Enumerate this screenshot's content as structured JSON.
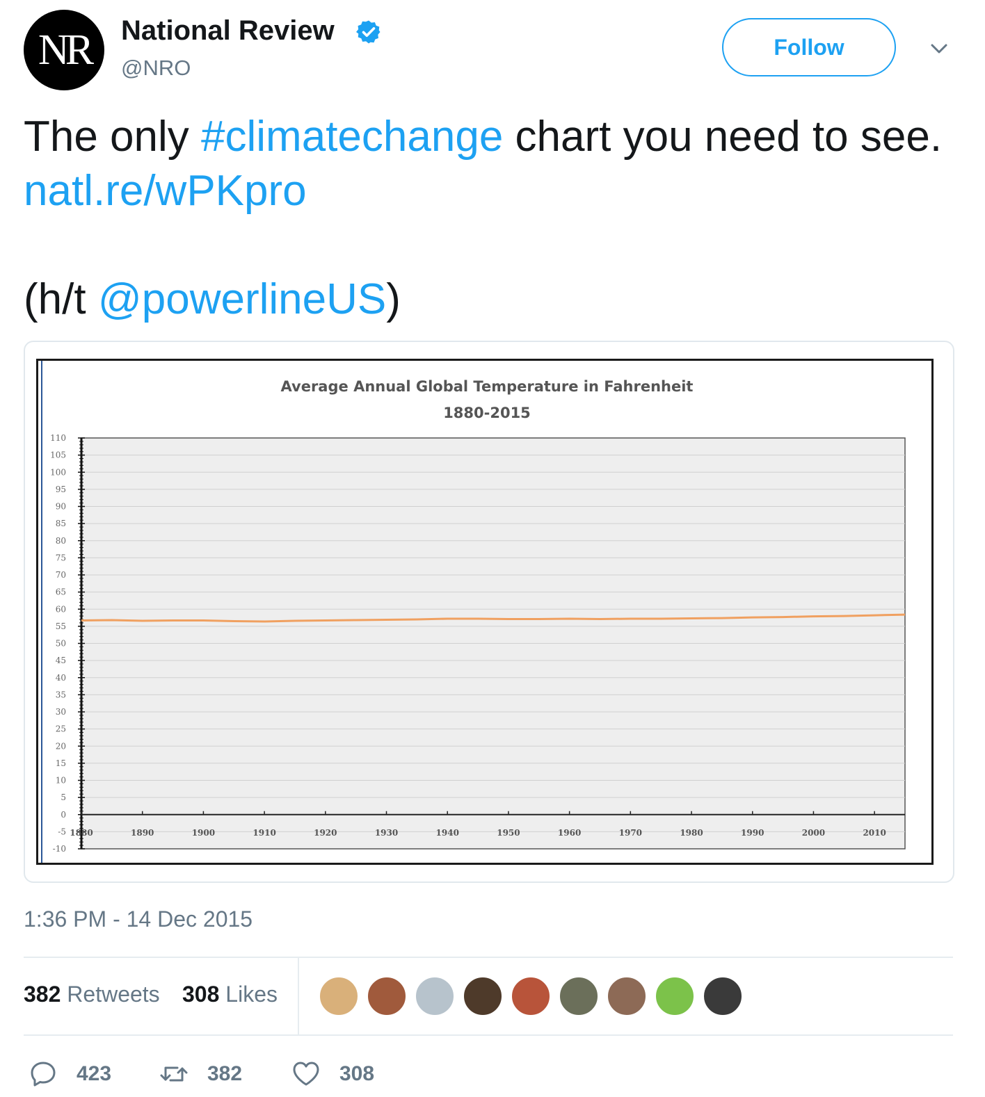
{
  "account": {
    "display_name": "National Review",
    "handle": "@NRO",
    "avatar_text": "NR",
    "verified": true,
    "follow_label": "Follow"
  },
  "tweet": {
    "text_1": "The only ",
    "hashtag": "#climatechange",
    "text_2": " chart you need to see. ",
    "link": "natl.re/wPKpro",
    "ht_open": "(h/t ",
    "mention": "@powerlineUS",
    "ht_close": ")",
    "timestamp": "1:36 PM - 14 Dec 2015"
  },
  "stats": {
    "retweets_count": "382",
    "retweets_label": "Retweets",
    "likes_count": "308",
    "likes_label": "Likes"
  },
  "actions": {
    "replies": "423",
    "retweets": "382",
    "likes": "308"
  },
  "liker_avatars": [
    {
      "name": "liker-avatar-1",
      "color": "#d9b07a"
    },
    {
      "name": "liker-avatar-2",
      "color": "#a05a3c"
    },
    {
      "name": "liker-avatar-3",
      "color": "#b7c3cc"
    },
    {
      "name": "liker-avatar-4",
      "color": "#4e3a2a"
    },
    {
      "name": "liker-avatar-5",
      "color": "#b8543a"
    },
    {
      "name": "liker-avatar-6",
      "color": "#6b6f5a"
    },
    {
      "name": "liker-avatar-7",
      "color": "#8d6a56"
    },
    {
      "name": "liker-avatar-8",
      "color": "#7cc24a"
    },
    {
      "name": "liker-avatar-9",
      "color": "#3a3a3a"
    }
  ],
  "colors": {
    "accent": "#1da1f2",
    "text": "#14171a",
    "muted": "#657786",
    "series": "#f0a060",
    "plot_bg": "#eeeeee"
  },
  "chart_data": {
    "type": "line",
    "title": "Average Annual Global Temperature in Fahrenheit",
    "subtitle": "1880-2015",
    "xlabel": "",
    "ylabel": "",
    "xlim": [
      1880,
      2015
    ],
    "ylim": [
      -10,
      110
    ],
    "y_ticks": [
      110,
      105,
      100,
      95,
      90,
      85,
      80,
      75,
      70,
      65,
      60,
      55,
      50,
      45,
      40,
      35,
      30,
      25,
      20,
      15,
      10,
      5,
      0,
      -5,
      -10
    ],
    "x_ticks": [
      1880,
      1890,
      1900,
      1910,
      1920,
      1930,
      1940,
      1950,
      1960,
      1970,
      1980,
      1990,
      2000,
      2010
    ],
    "grid": true,
    "series": [
      {
        "x": [
          1880,
          1885,
          1890,
          1895,
          1900,
          1905,
          1910,
          1915,
          1920,
          1925,
          1930,
          1935,
          1940,
          1945,
          1950,
          1955,
          1960,
          1965,
          1970,
          1975,
          1980,
          1985,
          1990,
          1995,
          2000,
          2005,
          2010,
          2015
        ],
        "y": [
          56.7,
          56.8,
          56.6,
          56.7,
          56.7,
          56.5,
          56.4,
          56.6,
          56.7,
          56.8,
          56.9,
          57.0,
          57.2,
          57.2,
          57.1,
          57.1,
          57.2,
          57.1,
          57.2,
          57.2,
          57.3,
          57.4,
          57.6,
          57.7,
          57.9,
          58.0,
          58.2,
          58.4
        ]
      }
    ]
  }
}
